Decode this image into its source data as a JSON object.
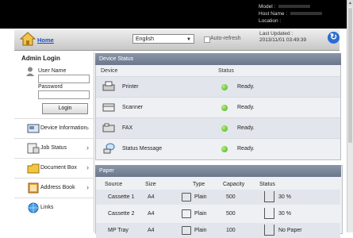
{
  "header": {
    "model_label": "Model :",
    "host_label": "Host Name :",
    "location_label": "Location :"
  },
  "nav": {
    "home": "Home",
    "language": "English",
    "auto_refresh": "Auto-refresh",
    "last_updated_label": "Last Updated :",
    "last_updated_value": "2013/11/01 03:49:39"
  },
  "login": {
    "title": "Admin Login",
    "user_label": "User Name",
    "password_label": "Password",
    "button": "Login"
  },
  "menu": [
    {
      "label": "Device Information"
    },
    {
      "label": "Job Status"
    },
    {
      "label": "Document Box"
    },
    {
      "label": "Address Book"
    },
    {
      "label": "Links"
    }
  ],
  "device_status": {
    "title": "Device Status",
    "col_device": "Device",
    "col_status": "Status",
    "rows": [
      {
        "device": "Printer",
        "status": "Ready."
      },
      {
        "device": "Scanner",
        "status": "Ready."
      },
      {
        "device": "FAX",
        "status": "Ready."
      },
      {
        "device": "Status Message",
        "status": "Ready."
      }
    ]
  },
  "paper": {
    "title": "Paper",
    "cols": [
      "Source",
      "Size",
      "Type",
      "Capacity",
      "Status"
    ],
    "rows": [
      {
        "source": "Cassette 1",
        "size": "A4",
        "type": "Plain",
        "capacity": "500",
        "status": "30 %"
      },
      {
        "source": "Cassette 2",
        "size": "A4",
        "type": "Plain",
        "capacity": "500",
        "status": "30 %"
      },
      {
        "source": "MP Tray",
        "size": "A4",
        "type": "Plain",
        "capacity": "100",
        "status": "No Paper"
      }
    ]
  },
  "colors": {
    "accent": "#2a6cd0",
    "panel_header": "#7a869a",
    "ready": "#3fae1c"
  }
}
